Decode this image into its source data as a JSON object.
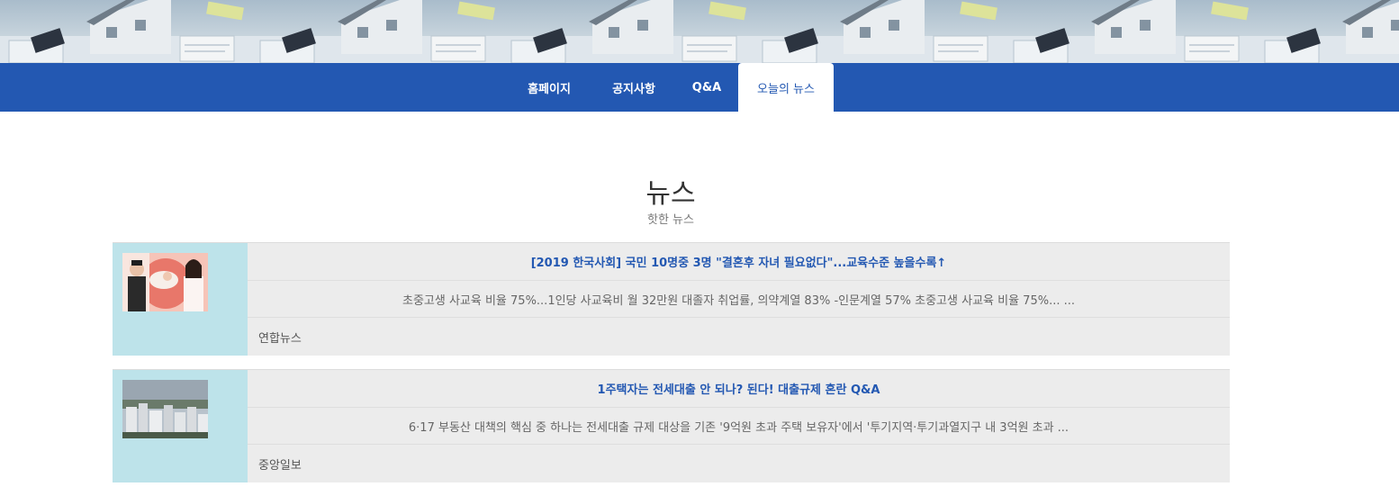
{
  "nav": {
    "items": [
      {
        "label": "홈페이지",
        "active": false
      },
      {
        "label": "공지사항",
        "active": false
      },
      {
        "label": "Q&A",
        "active": false
      },
      {
        "label": "오늘의 뉴스",
        "active": true
      }
    ]
  },
  "section": {
    "title": "뉴스",
    "subtitle": "핫한 뉴스"
  },
  "news": [
    {
      "title": "[2019 한국사회] 국민 10명중 3명 \"결혼후 자녀 필요없다\"...교육수준 높을수록↑",
      "summary": "초중고생 사교육 비율 75%...1인당 사교육비 월 32만원 대졸자 취업률, 의약계열 83% -인문계열 57% 초중고생 사교육 비율 75%... ...",
      "source": "연합뉴스",
      "thumbnail_icon": "family-photo-icon"
    },
    {
      "title": "1주택자는 전세대출 안 되나? 된다! 대출규제 혼란 Q&A",
      "summary": "6·17 부동산 대책의 핵심 중 하나는 전세대출 규제 대상을 기존 '9억원 초과 주택 보유자'에서 '투기지역·투기과열지구 내 3억원 초과 ...",
      "source": "중앙일보",
      "thumbnail_icon": "apartment-city-icon"
    }
  ],
  "colors": {
    "nav_background": "#2358b2",
    "title_link": "#2358b2",
    "thumb_column": "#bde3ea",
    "card_body": "#ececec"
  }
}
